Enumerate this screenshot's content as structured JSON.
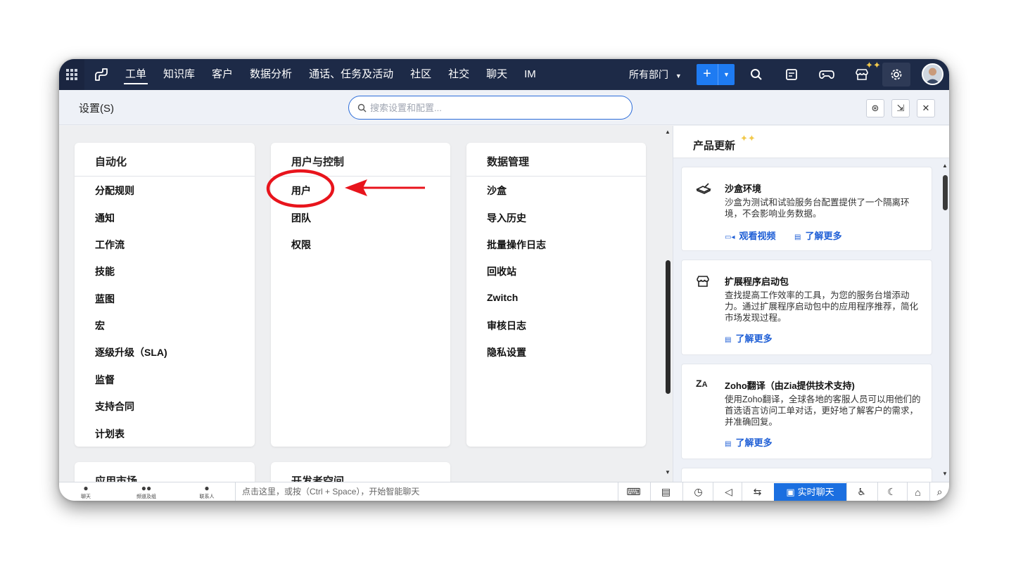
{
  "topbar": {
    "nav": [
      "工单",
      "知识库",
      "客户",
      "数据分析",
      "通话、任务及活动",
      "社区",
      "社交",
      "聊天",
      "IM"
    ],
    "department": "所有部门",
    "add_label": "+"
  },
  "settings": {
    "title": "设置(S)",
    "search_placeholder": "搜索设置和配置..."
  },
  "cards": [
    {
      "title": "自动化",
      "items": [
        "分配规则",
        "通知",
        "工作流",
        "技能",
        "蓝图",
        "宏",
        "逐级升级（SLA)",
        "监督",
        "支持合同",
        "计划表"
      ]
    },
    {
      "title": "用户与控制",
      "items": [
        "用户",
        "团队",
        "权限"
      ]
    },
    {
      "title": "数据管理",
      "items": [
        "沙盒",
        "导入历史",
        "批量操作日志",
        "回收站",
        "Zwitch",
        "审核日志",
        "隐私设置"
      ]
    },
    {
      "title": "应用市场",
      "items": []
    },
    {
      "title": "开发者空间",
      "items": []
    }
  ],
  "panel": {
    "title": "产品更新",
    "updates": [
      {
        "title": "沙盒环境",
        "desc": "沙盒为测试和试验服务台配置提供了一个隔离环境，不会影响业务数据。",
        "links": [
          "观看视频",
          "了解更多"
        ],
        "icon": "sandbox-icon"
      },
      {
        "title": "扩展程序启动包",
        "desc": "查找提高工作效率的工具，为您的服务台增添动力。通过扩展程序启动包中的应用程序推荐，简化市场发现过程。",
        "links": [
          "了解更多"
        ],
        "icon": "store-icon"
      },
      {
        "title": "Zoho翻译（由Zia提供技术支持)",
        "desc": "使用Zoho翻译，全球各地的客服人员可以用他们的首选语言访问工单对话，更好地了解客户的需求，并准确回复。",
        "links": [
          "了解更多"
        ],
        "icon": "translate-icon"
      }
    ]
  },
  "bottombar": {
    "tabs": [
      "聊天",
      "频道及组",
      "联系人"
    ],
    "prompt": "点击这里，或按（Ctrl + Space），开始智能聊天",
    "live_chat": "实时聊天"
  },
  "colors": {
    "topbar": "#1d2a47",
    "accent": "#1e7bf2",
    "annotation": "#e8141c"
  }
}
